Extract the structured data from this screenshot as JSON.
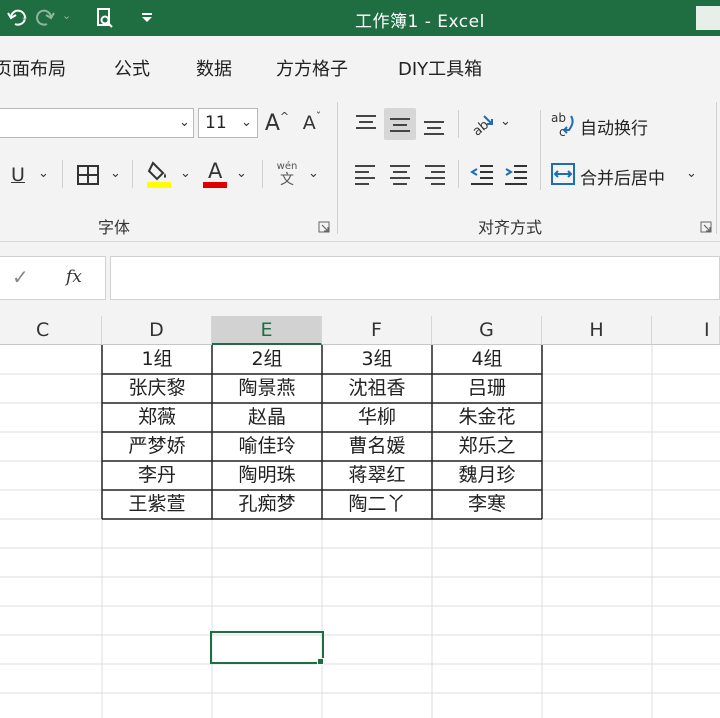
{
  "window": {
    "title": "工作簿1 - Excel"
  },
  "ribbon_tabs": [
    "页面布局",
    "公式",
    "数据",
    "方方格子",
    "DIY工具箱"
  ],
  "font_group": {
    "font_name": "",
    "font_size": "11",
    "grow_label": "A",
    "shrink_label": "A",
    "underline_label": "U",
    "font_color_label": "A",
    "phonetic_label": "wén",
    "phonetic_char": "文",
    "group_label": "字体",
    "fill_color": "#ffff00",
    "font_color": "#e00000"
  },
  "alignment_group": {
    "wrap_text_label": "自动换行",
    "merge_center_label": "合并后居中",
    "group_label": "对齐方式"
  },
  "formula_bar": {
    "cancel_glyph": "✓",
    "fx_label": "fx",
    "value": ""
  },
  "sheet": {
    "columns": [
      "C",
      "D",
      "E",
      "F",
      "G",
      "H",
      "I"
    ],
    "selected_column": "E",
    "table_headers": [
      "1组",
      "2组",
      "3组",
      "4组"
    ],
    "table_rows": [
      [
        "张庆黎",
        "陶景燕",
        "沈祖香",
        "吕珊"
      ],
      [
        "郑薇",
        "赵晶",
        "华柳",
        "朱金花"
      ],
      [
        "严梦娇",
        "喻佳玲",
        "曹名媛",
        "郑乐之"
      ],
      [
        "李丹",
        "陶明珠",
        "蒋翠红",
        "魏月珍"
      ],
      [
        "王紫萱",
        "孔痴梦",
        "陶二丫",
        "李寒"
      ]
    ]
  },
  "colors": {
    "title_bar": "#1e6e42",
    "ribbon_bg": "#f3f3f3",
    "gridline": "#dcdcdc",
    "table_border": "#222222"
  }
}
